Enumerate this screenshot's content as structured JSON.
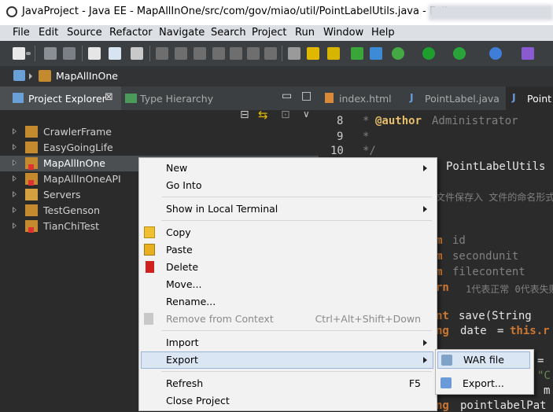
{
  "window": {
    "title": "JavaProject - Java EE - MapAllInOne/src/com/gov/miao/util/PointLabelUtils.java - Eclipse"
  },
  "menubar": [
    "File",
    "Edit",
    "Source",
    "Refactor",
    "Navigate",
    "Search",
    "Project",
    "Run",
    "Window",
    "Help"
  ],
  "breadcrumb": {
    "project": "MapAllInOne"
  },
  "explorer": {
    "tabs": [
      {
        "label": "Project Explorer"
      },
      {
        "label": "Type Hierarchy"
      }
    ],
    "projects": [
      "CrawlerFrame",
      "EasyGoingLife",
      "MapAllInOne",
      "MapAllInOneAPI",
      "Servers",
      "TestGenson",
      "TianChiTest"
    ],
    "selected": "MapAllInOne"
  },
  "editor": {
    "tabs": [
      "index.html",
      "PointLabel.java",
      "Point"
    ],
    "lines": [
      {
        "num": "8",
        "star": "*",
        "tag": "@author",
        "text": "Administrator"
      },
      {
        "num": "9",
        "star": "*"
      },
      {
        "num": "10",
        "star": "*/"
      }
    ],
    "fragments": {
      "class_name": "PointLabelUtils",
      "comment_cn": "文件保存入 文件的命名形式",
      "p1_kw": "m",
      "p1": "id",
      "p2_kw": "m",
      "p2": "secondunit",
      "p3_kw": "m",
      "p3": "filecontent",
      "ret_kw": "rn",
      "ret_cn": "1代表正常 0代表失败",
      "m_kw": "nt",
      "m_sig": "save(String",
      "d_kw": "ng",
      "d_var": "date",
      "d_eq": "=",
      "d_this": "this.r",
      "s_eq": "=",
      "s_str": "\"C",
      "s_tail": "m",
      "l_kw": "ng",
      "l_var": "pointlabelPat"
    }
  },
  "context_menu": {
    "new": "New",
    "go_into": "Go Into",
    "show_terminal": "Show in Local Terminal",
    "copy": "Copy",
    "paste": "Paste",
    "delete": "Delete",
    "move": "Move...",
    "rename": "Rename...",
    "remove_context": "Remove from Context",
    "remove_context_shortcut": "Ctrl+Alt+Shift+Down",
    "import": "Import",
    "export": "Export",
    "refresh": "Refresh",
    "refresh_shortcut": "F5",
    "close_project": "Close Project"
  },
  "export_submenu": {
    "war_file": "WAR file",
    "export": "Export..."
  },
  "colors": {
    "bg": "#2b2b2b",
    "menu_bg": "#f2f2f2",
    "highlight": "#dbe6f4",
    "keyword": "#cc7832",
    "comment": "#808080",
    "javadoc_tag": "#e8bf6a"
  }
}
